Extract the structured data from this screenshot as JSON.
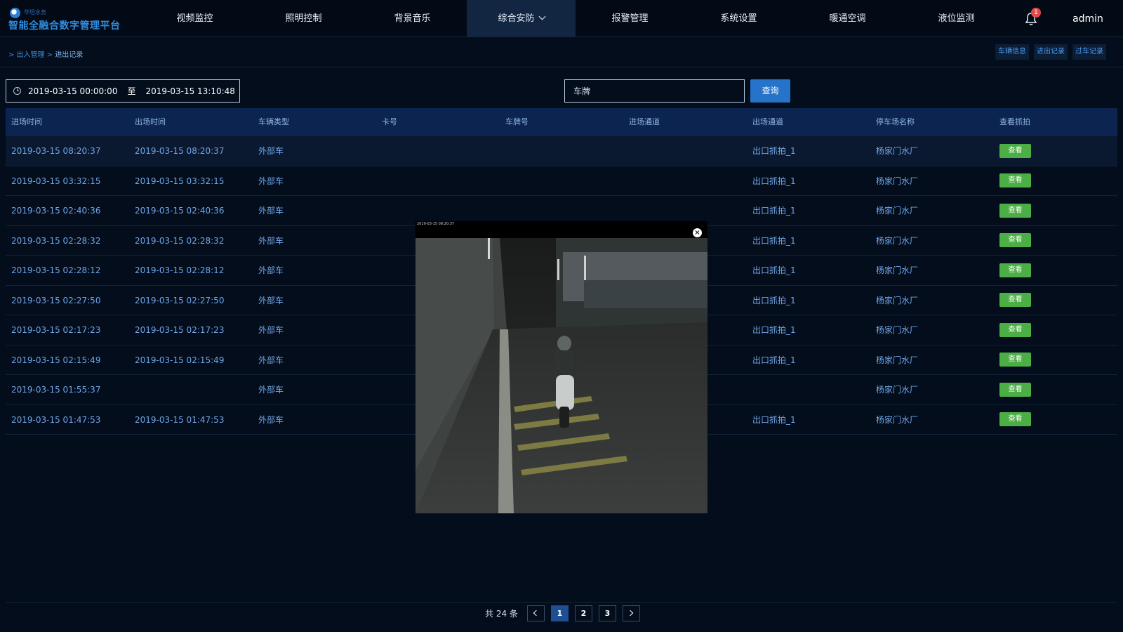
{
  "header": {
    "logo_en": "华坦水务",
    "logo_title": "智能全融合数字管理平台",
    "nav": [
      {
        "label": "视频监控",
        "active": false
      },
      {
        "label": "照明控制",
        "active": false
      },
      {
        "label": "背景音乐",
        "active": false
      },
      {
        "label": "综合安防",
        "active": true
      },
      {
        "label": "报警管理",
        "active": false
      },
      {
        "label": "系统设置",
        "active": false
      },
      {
        "label": "暖通空调",
        "active": false
      },
      {
        "label": "液位监测",
        "active": false
      }
    ],
    "notification_count": "1",
    "user": "admin"
  },
  "breadcrumb": {
    "parent": "> 出入管理 >",
    "current": "进出记录"
  },
  "quick_links": [
    "车辆信息",
    "进出记录",
    "过车记录"
  ],
  "filters": {
    "start_time": "2019-03-15 00:00:00",
    "separator": "至",
    "end_time": "2019-03-15 13:10:48",
    "plate_placeholder": "车牌",
    "query_label": "查询"
  },
  "table": {
    "columns": [
      "进场时间",
      "出场时间",
      "车辆类型",
      "卡号",
      "车牌号",
      "进场通道",
      "出场通道",
      "停车场名称",
      "查看抓拍"
    ],
    "view_label": "查看",
    "rows": [
      {
        "in": "2019-03-15 08:20:37",
        "out": "2019-03-15 08:20:37",
        "type": "外部车",
        "card": "",
        "plate": "",
        "in_ch": "",
        "out_ch": "出口抓拍_1",
        "lot": "杨家门水厂"
      },
      {
        "in": "2019-03-15 03:32:15",
        "out": "2019-03-15 03:32:15",
        "type": "外部车",
        "card": "",
        "plate": "",
        "in_ch": "",
        "out_ch": "出口抓拍_1",
        "lot": "杨家门水厂"
      },
      {
        "in": "2019-03-15 02:40:36",
        "out": "2019-03-15 02:40:36",
        "type": "外部车",
        "card": "",
        "plate": "",
        "in_ch": "",
        "out_ch": "出口抓拍_1",
        "lot": "杨家门水厂"
      },
      {
        "in": "2019-03-15 02:28:32",
        "out": "2019-03-15 02:28:32",
        "type": "外部车",
        "card": "",
        "plate": "",
        "in_ch": "",
        "out_ch": "出口抓拍_1",
        "lot": "杨家门水厂"
      },
      {
        "in": "2019-03-15 02:28:12",
        "out": "2019-03-15 02:28:12",
        "type": "外部车",
        "card": "",
        "plate": "",
        "in_ch": "",
        "out_ch": "出口抓拍_1",
        "lot": "杨家门水厂"
      },
      {
        "in": "2019-03-15 02:27:50",
        "out": "2019-03-15 02:27:50",
        "type": "外部车",
        "card": "",
        "plate": "",
        "in_ch": "",
        "out_ch": "出口抓拍_1",
        "lot": "杨家门水厂"
      },
      {
        "in": "2019-03-15 02:17:23",
        "out": "2019-03-15 02:17:23",
        "type": "外部车",
        "card": "",
        "plate": "",
        "in_ch": "",
        "out_ch": "出口抓拍_1",
        "lot": "杨家门水厂"
      },
      {
        "in": "2019-03-15 02:15:49",
        "out": "2019-03-15 02:15:49",
        "type": "外部车",
        "card": "",
        "plate": "",
        "in_ch": "",
        "out_ch": "出口抓拍_1",
        "lot": "杨家门水厂"
      },
      {
        "in": "2019-03-15 01:55:37",
        "out": "",
        "type": "外部车",
        "card": "",
        "plate": "",
        "in_ch": "",
        "out_ch": "",
        "lot": "杨家门水厂"
      },
      {
        "in": "2019-03-15 01:47:53",
        "out": "2019-03-15 01:47:53",
        "type": "外部车",
        "card": "",
        "plate": "",
        "in_ch": "",
        "out_ch": "出口抓拍_1",
        "lot": "杨家门水厂"
      }
    ]
  },
  "snapshot_modal": {
    "caption": "2019-03-15 08:20:37",
    "close_icon": "close-icon"
  },
  "pagination": {
    "total": "共 24 条",
    "pages": [
      "1",
      "2",
      "3"
    ],
    "current": "1"
  },
  "colors": {
    "background": "#030d1c",
    "accent": "#2674c9",
    "view_button": "#4caf46",
    "row_text": "#6fa6e8"
  }
}
